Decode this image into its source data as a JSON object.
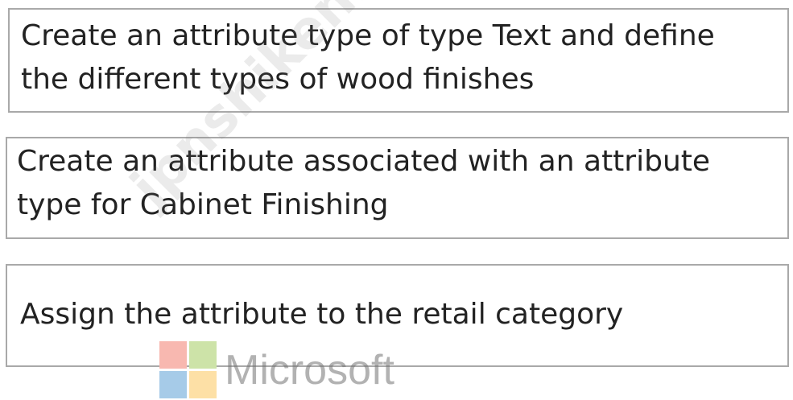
{
  "steps": [
    {
      "text": "Create an attribute type of type Text and define\nthe different types of wood finishes"
    },
    {
      "text": "Create an attribute associated with an attribute\ntype for Cabinet Finishing"
    },
    {
      "text": "Assign the attribute to the retail category"
    }
  ],
  "watermark": {
    "text": "jpnshiken.com"
  },
  "logo": {
    "name": "Microsoft",
    "wordmark": "Microsoft",
    "colors": [
      "#f8b8b0",
      "#cde3a8",
      "#a6cbe8",
      "#fde0a6"
    ]
  }
}
